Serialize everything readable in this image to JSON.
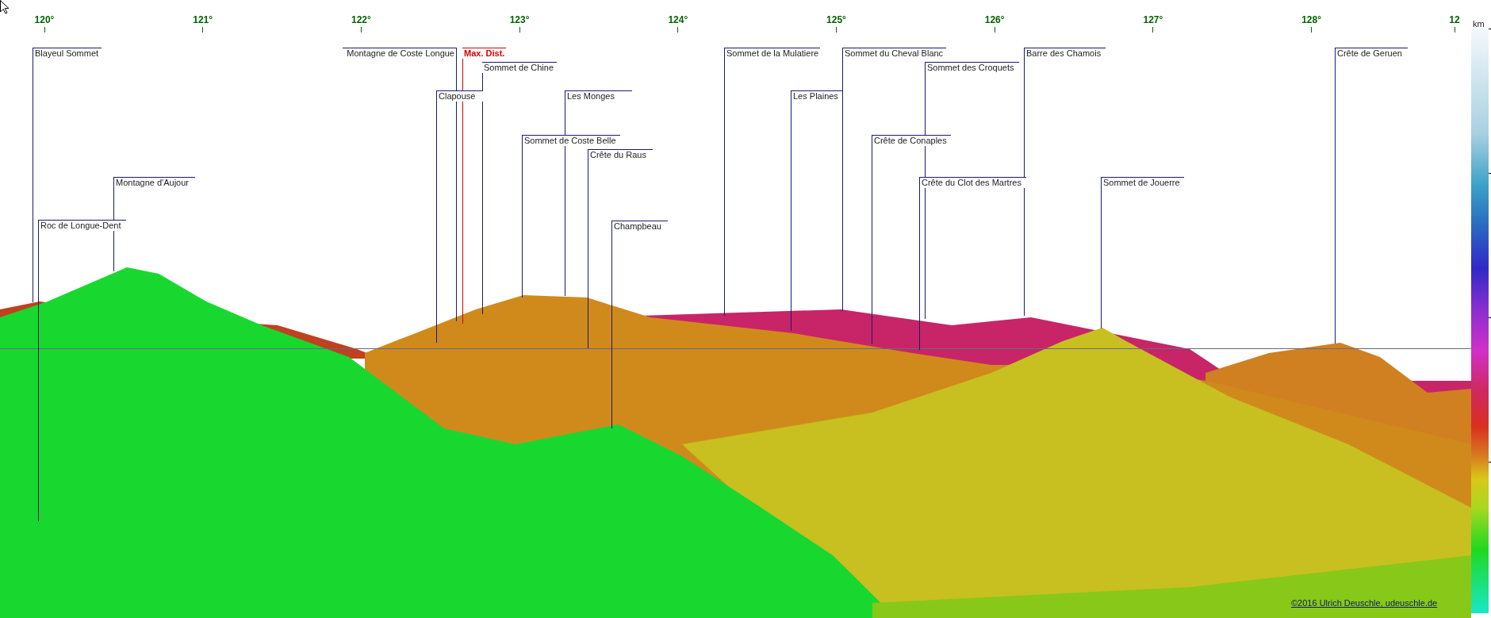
{
  "axis": {
    "ticks": [
      "120°",
      "121°",
      "122°",
      "123°",
      "124°",
      "125°",
      "126°",
      "127°",
      "128°",
      "12"
    ]
  },
  "labels": [
    {
      "text": "Blayeul Sommet",
      "kind": "peak"
    },
    {
      "text": "Montagne de Coste Longue",
      "kind": "peak"
    },
    {
      "text": "Max. Dist.",
      "kind": "max_dist"
    },
    {
      "text": "Sommet de Chine",
      "kind": "peak"
    },
    {
      "text": "Clapouse",
      "kind": "peak"
    },
    {
      "text": "Les Monges",
      "kind": "peak"
    },
    {
      "text": "Sommet de Coste Belle",
      "kind": "peak"
    },
    {
      "text": "Crête du Raus",
      "kind": "peak"
    },
    {
      "text": "Montagne d'Aujour",
      "kind": "peak"
    },
    {
      "text": "Roc de Longue-Dent",
      "kind": "peak"
    },
    {
      "text": "Champbeau",
      "kind": "peak"
    },
    {
      "text": "Sommet de la Mulatiere",
      "kind": "peak"
    },
    {
      "text": "Sommet du Cheval Blanc",
      "kind": "peak"
    },
    {
      "text": "Les Plaines",
      "kind": "peak"
    },
    {
      "text": "Sommet des Croquets",
      "kind": "peak"
    },
    {
      "text": "Barre des Chamois",
      "kind": "peak"
    },
    {
      "text": "Crête de Conaples",
      "kind": "peak"
    },
    {
      "text": "Crête du Clot des Martres",
      "kind": "peak"
    },
    {
      "text": "Sommet de Jouerre",
      "kind": "peak"
    },
    {
      "text": "Crête de Geruen",
      "kind": "peak"
    }
  ],
  "scale": {
    "unit": "km"
  },
  "copyright": "©2016 Ulrich Deuschle, udeuschle.de"
}
